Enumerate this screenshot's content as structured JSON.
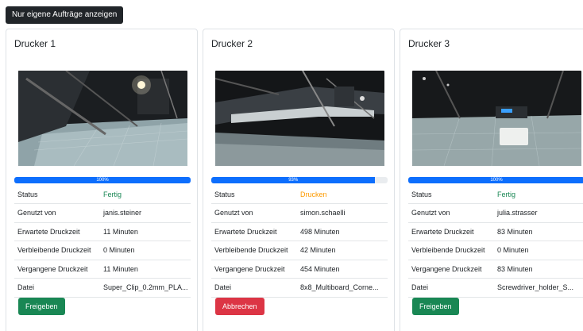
{
  "toolbar": {
    "own_jobs_label": "Nur eigene Aufträge anzeigen"
  },
  "labels": {
    "status": "Status",
    "used_by": "Genutzt von",
    "expected": "Erwartete Druckzeit",
    "remaining": "Verbleibende Druckzeit",
    "elapsed": "Vergangene Druckzeit",
    "file": "Datei"
  },
  "colors": {
    "primary": "#0d6efd",
    "success": "#198754",
    "danger": "#dc3545",
    "warning": "#fd9a00"
  },
  "printers": [
    {
      "title": "Drucker 1",
      "progress": 100,
      "progress_label": "100%",
      "status": "Fertig",
      "used_by": "janis.steiner",
      "expected": "11 Minuten",
      "remaining": "0 Minuten",
      "elapsed": "11 Minuten",
      "file": "Super_Clip_0.2mm_PLA...",
      "action": "Freigeben"
    },
    {
      "title": "Drucker 2",
      "progress": 93,
      "progress_label": "93%",
      "status": "Drucken",
      "used_by": "simon.schaelli",
      "expected": "498 Minuten",
      "remaining": "42 Minuten",
      "elapsed": "454 Minuten",
      "file": "8x8_Multiboard_Corne...",
      "action": "Abbrechen"
    },
    {
      "title": "Drucker 3",
      "progress": 100,
      "progress_label": "100%",
      "status": "Fertig",
      "used_by": "julia.strasser",
      "expected": "83 Minuten",
      "remaining": "0 Minuten",
      "elapsed": "83 Minuten",
      "file": "Screwdriver_holder_S...",
      "action": "Freigeben"
    }
  ]
}
